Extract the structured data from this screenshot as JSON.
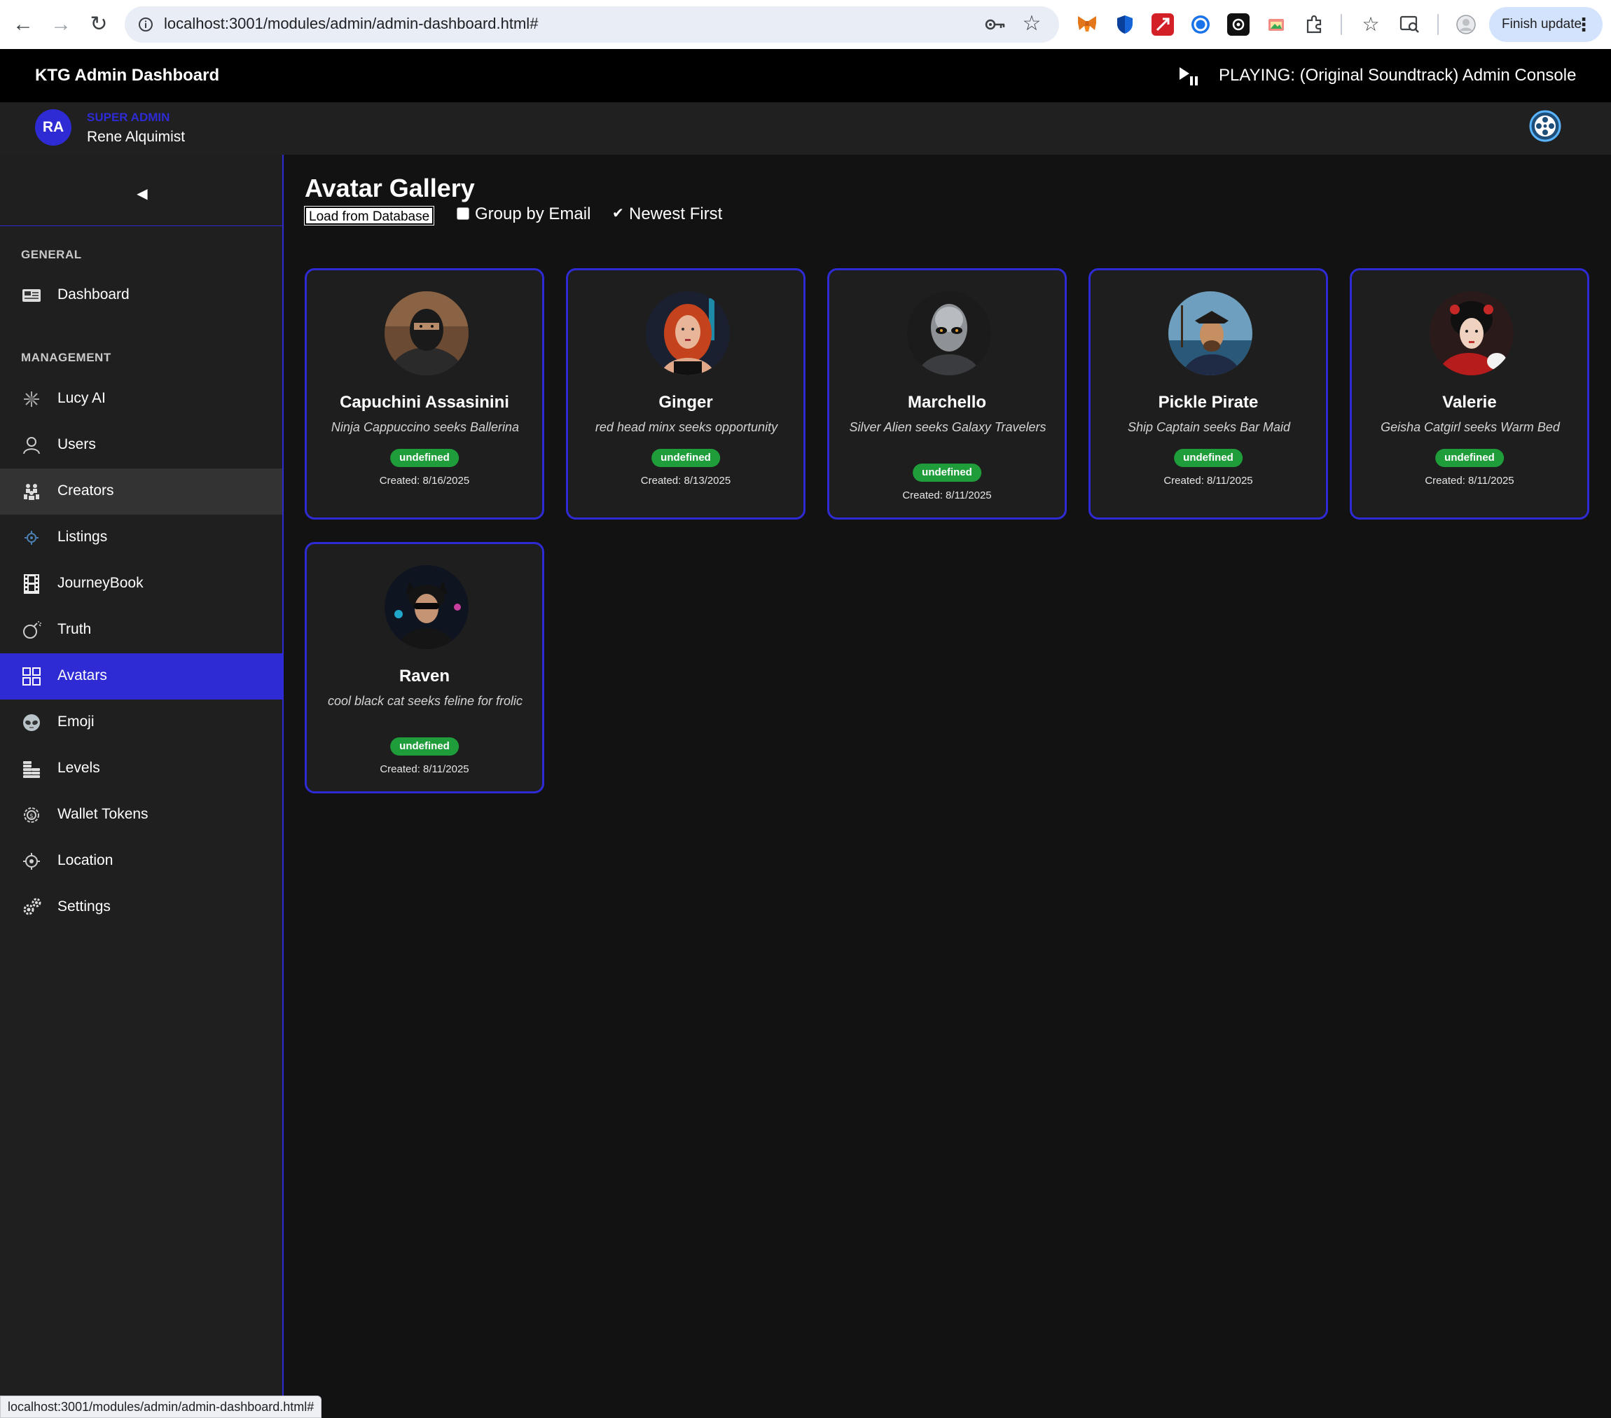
{
  "browser": {
    "url": "localhost:3001/modules/admin/admin-dashboard.html#",
    "finish_update": "Finish update",
    "status_url": "localhost:3001/modules/admin/admin-dashboard.html#"
  },
  "header": {
    "title": "KTG Admin Dashboard",
    "now_playing": "PLAYING: (Original Soundtrack) Admin Console"
  },
  "user": {
    "initials": "RA",
    "role": "SUPER ADMIN",
    "name": "Rene Alquimist"
  },
  "sidebar": {
    "sections": {
      "general": "GENERAL",
      "management": "MANAGEMENT"
    },
    "items": [
      {
        "label": "Dashboard",
        "icon": "dashboard-icon"
      },
      {
        "label": "Lucy AI",
        "icon": "sparkle-icon"
      },
      {
        "label": "Users",
        "icon": "user-icon"
      },
      {
        "label": "Creators",
        "icon": "group-icon"
      },
      {
        "label": "Listings",
        "icon": "target-icon"
      },
      {
        "label": "JourneyBook",
        "icon": "film-strip-icon"
      },
      {
        "label": "Truth",
        "icon": "bomb-icon"
      },
      {
        "label": "Avatars",
        "icon": "grid-icon"
      },
      {
        "label": "Emoji",
        "icon": "alien-icon"
      },
      {
        "label": "Levels",
        "icon": "coins-icon"
      },
      {
        "label": "Wallet Tokens",
        "icon": "token-gear-icon"
      },
      {
        "label": "Location",
        "icon": "location-icon"
      },
      {
        "label": "Settings",
        "icon": "gears-icon"
      }
    ],
    "active": "Avatars",
    "hovered": "Creators"
  },
  "gallery": {
    "title": "Avatar Gallery",
    "load_button": "Load from Database",
    "group_by_email": "Group by Email",
    "group_by_email_checked": false,
    "newest_first": "Newest First",
    "newest_first_checked": true,
    "cards": [
      {
        "name": "Capuchini Assasinini",
        "tagline": "Ninja Cappuccino seeks Ballerina",
        "badge": "undefined",
        "created": "Created: 8/16/2025"
      },
      {
        "name": "Ginger",
        "tagline": "red head minx seeks opportunity",
        "badge": "undefined",
        "created": "Created: 8/13/2025"
      },
      {
        "name": "Marchello",
        "tagline": "Silver Alien seeks Galaxy Travelers",
        "badge": "undefined",
        "created": "Created: 8/11/2025"
      },
      {
        "name": "Pickle Pirate",
        "tagline": "Ship Captain seeks Bar Maid",
        "badge": "undefined",
        "created": "Created: 8/11/2025"
      },
      {
        "name": "Valerie",
        "tagline": "Geisha Catgirl seeks Warm Bed",
        "badge": "undefined",
        "created": "Created: 8/11/2025"
      },
      {
        "name": "Raven",
        "tagline": "cool black cat seeks feline for frolic",
        "badge": "undefined",
        "created": "Created: 8/11/2025"
      }
    ]
  },
  "colors": {
    "accent": "#2f2bd4",
    "badge_green": "#1f9d3a",
    "background": "#121212",
    "sidebar": "#1f1f1f"
  }
}
